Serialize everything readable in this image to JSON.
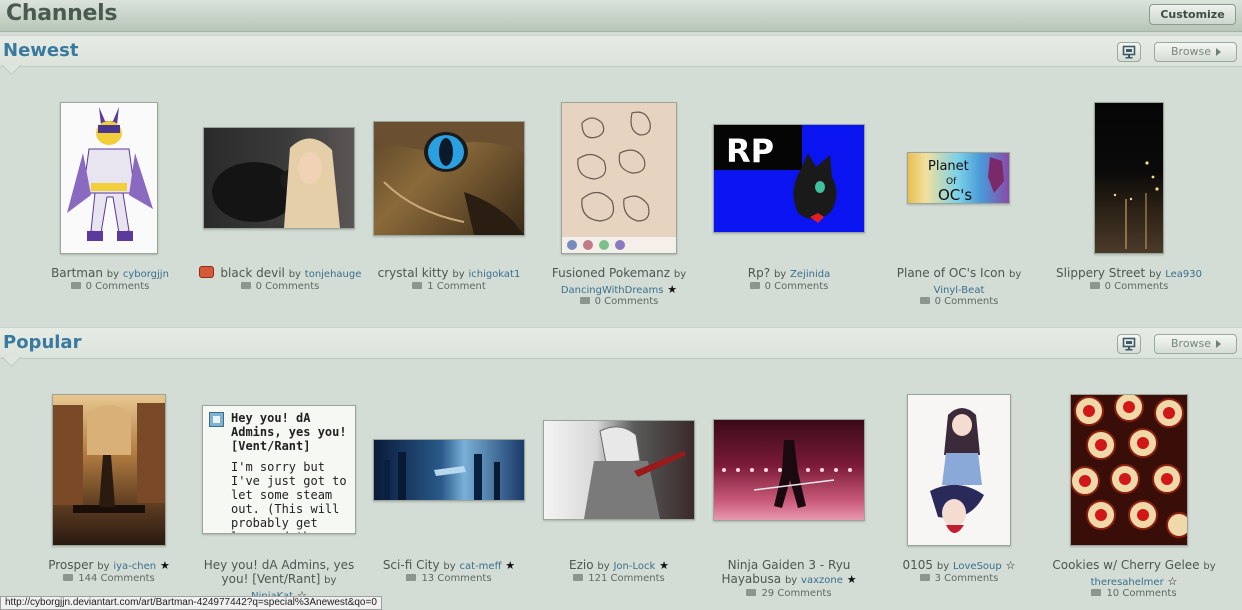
{
  "header": {
    "title": "Channels",
    "customize_label": "Customize"
  },
  "sections": [
    {
      "title": "Newest",
      "browse_label": "Browse",
      "items": [
        {
          "title": "Bartman",
          "by": "by",
          "user": "cyborgjjn",
          "comments": "0 Comments"
        },
        {
          "title": "black devil",
          "by": "by",
          "user": "tonjehauge",
          "comments": "0 Comments"
        },
        {
          "title": "crystal kitty",
          "by": "by",
          "user": "ichigokat1",
          "comments": "1 Comment"
        },
        {
          "title": "Fusioned Pokemanz",
          "by": "by",
          "user": "DancingWithDreams",
          "comments": "0 Comments"
        },
        {
          "title": "Rp?",
          "by": "by",
          "user": "Zejinida",
          "comments": "0 Comments",
          "thumb_text": "RP"
        },
        {
          "title": "Plane of OC's Icon",
          "by": "by",
          "user": "Vinyl-Beat",
          "comments": "0 Comments",
          "thumb_text": [
            "Planet",
            "Of",
            "OC's"
          ]
        },
        {
          "title": "Slippery Street",
          "by": "by",
          "user": "Lea930",
          "comments": "0 Comments"
        }
      ]
    },
    {
      "title": "Popular",
      "browse_label": "Browse",
      "items": [
        {
          "title": "Prosper",
          "by": "by",
          "user": "iya-chen",
          "comments": "144 Comments"
        },
        {
          "title": "Hey you! dA Admins, yes you! [Vent/Rant]",
          "by": "by",
          "user": "NinjaKat",
          "journal_title": "Hey you! dA Admins, yes you! [Vent/Rant]",
          "journal_body": "I'm sorry but I've just got to let some steam out. (This will probably get long and there"
        },
        {
          "title": "Sci-fi City",
          "by": "by",
          "user": "cat-meff",
          "comments": "13 Comments"
        },
        {
          "title": "Ezio",
          "by": "by",
          "user": "Jon-Lock",
          "comments": "121 Comments"
        },
        {
          "title": "Ninja Gaiden 3 - Ryu Hayabusa",
          "by": "by",
          "user": "vaxzone",
          "comments": "29 Comments"
        },
        {
          "title": "0105",
          "by": "by",
          "user": "LoveSoup",
          "comments": "3 Comments"
        },
        {
          "title": "Cookies w/ Cherry Gelee",
          "by": "by",
          "user": "theresahelmer",
          "comments": "10 Comments"
        }
      ]
    }
  ],
  "status_url": "http://cyborgjjn.deviantart.com/art/Bartman-424977442?q=special%3Anewest&qo=0",
  "icons": {
    "comment": "comment-icon",
    "monitor": "monitor-icon",
    "browse": "arrow-right-icon",
    "star": "star-icon",
    "star_outline": "star-outline-icon"
  },
  "colors": {
    "title_blue": "#3a7a9e",
    "user_link": "#3a6f8c",
    "background": "#d4ddd5"
  }
}
